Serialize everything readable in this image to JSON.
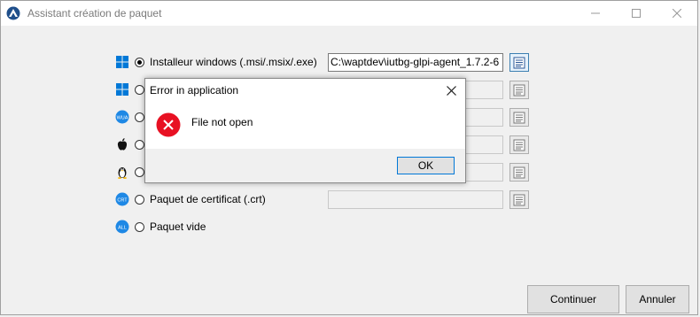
{
  "window": {
    "title": "Assistant création de paquet"
  },
  "options": [
    {
      "icon": "windows-icon",
      "label": "Installeur windows (.msi/.msix/.exe)",
      "selected": true,
      "path": "C:\\waptdev\\iutbg-glpi-agent_1.7.2-6"
    },
    {
      "icon": "windows-icon",
      "label": "",
      "selected": false,
      "path": ""
    },
    {
      "icon": "wua-icon",
      "icon_text": "WUA",
      "label": "",
      "selected": false,
      "path": ""
    },
    {
      "icon": "apple-icon",
      "label": "",
      "selected": false,
      "path": ""
    },
    {
      "icon": "linux-icon",
      "label": "",
      "selected": false,
      "path": ""
    },
    {
      "icon": "crt-icon",
      "icon_text": "CRT",
      "label": "Paquet de certificat (.crt)",
      "selected": false,
      "path": ""
    },
    {
      "icon": "all-icon",
      "icon_text": "ALL",
      "label": "Paquet vide",
      "selected": false
    }
  ],
  "buttons": {
    "continue": "Continuer",
    "cancel": "Annuler"
  },
  "dialog": {
    "title": "Error in application",
    "message": "File not open",
    "ok": "OK"
  },
  "colors": {
    "accent": "#0078d7",
    "error": "#e81123",
    "badge": "#1e88e5"
  }
}
